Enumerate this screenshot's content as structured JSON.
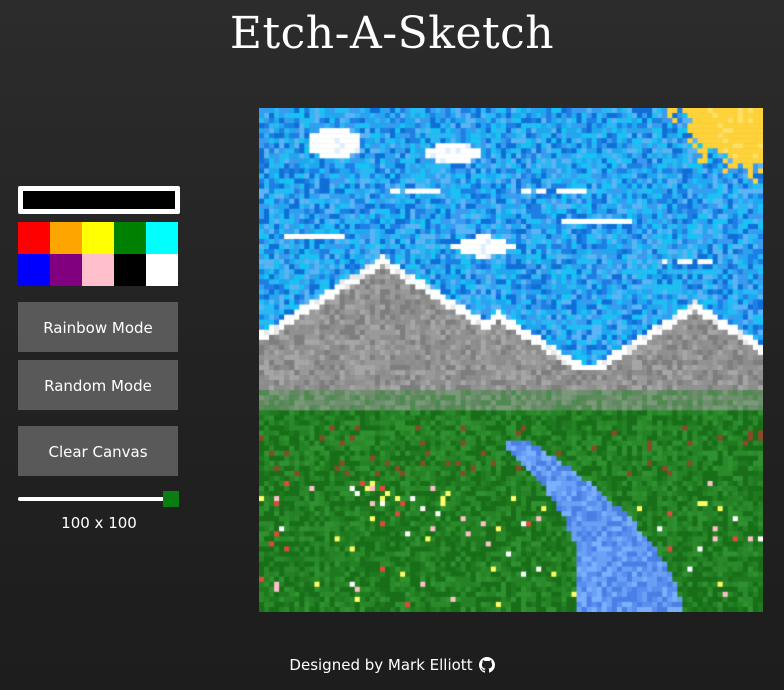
{
  "header": {
    "title": "Etch-A-Sketch"
  },
  "controls": {
    "current_color": "#000000",
    "palette": [
      {
        "name": "red",
        "hex": "#ff0000"
      },
      {
        "name": "orange",
        "hex": "#ffa500"
      },
      {
        "name": "yellow",
        "hex": "#ffff00"
      },
      {
        "name": "green",
        "hex": "#008000"
      },
      {
        "name": "cyan",
        "hex": "#00ffff"
      },
      {
        "name": "blue",
        "hex": "#0000ff"
      },
      {
        "name": "purple",
        "hex": "#800080"
      },
      {
        "name": "pink",
        "hex": "#ffc0cb"
      },
      {
        "name": "black",
        "hex": "#000000"
      },
      {
        "name": "white",
        "hex": "#ffffff"
      }
    ],
    "rainbow_label": "Rainbow Mode",
    "random_label": "Random Mode",
    "clear_label": "Clear Canvas",
    "grid_size_value": 100,
    "grid_size_label": "100 x 100",
    "slider_color": "#0a7d12"
  },
  "footer": {
    "credit": "Designed by Mark Elliott",
    "icon": "github-icon"
  }
}
